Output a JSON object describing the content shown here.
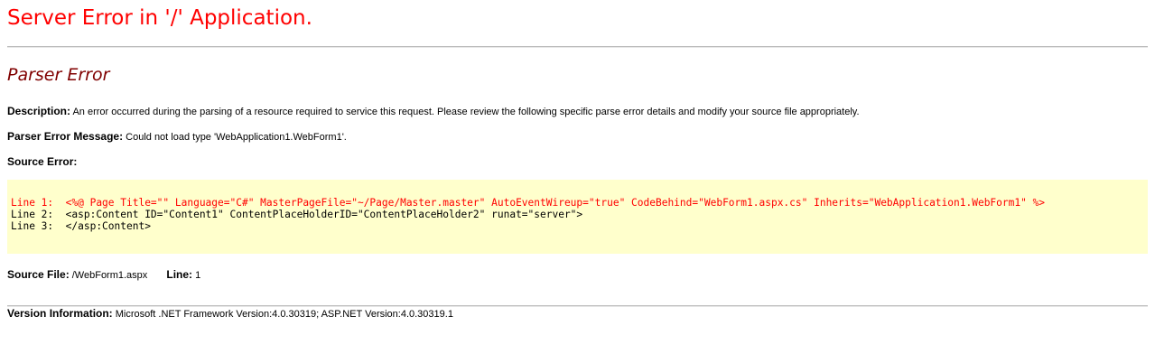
{
  "page_title": "Server Error in '/' Application.",
  "error_heading": "Parser Error",
  "description": {
    "label": "Description:",
    "text": "An error occurred during the parsing of a resource required to service this request. Please review the following specific parse error details and modify your source file appropriately."
  },
  "parser_error_message": {
    "label": "Parser Error Message:",
    "text": "Could not load type 'WebApplication1.WebForm1'."
  },
  "source_error": {
    "label": "Source Error:",
    "lines": [
      {
        "prefix": "Line 1:",
        "code": "<%@ Page Title=\"\" Language=\"C#\" MasterPageFile=\"~/Page/Master.master\" AutoEventWireup=\"true\" CodeBehind=\"WebForm1.aspx.cs\" Inherits=\"WebApplication1.WebForm1\" %>",
        "highlighted": true
      },
      {
        "prefix": "Line 2:",
        "code": "<asp:Content ID=\"Content1\" ContentPlaceHolderID=\"ContentPlaceHolder2\" runat=\"server\">",
        "highlighted": false
      },
      {
        "prefix": "Line 3:",
        "code": "</asp:Content>",
        "highlighted": false
      }
    ]
  },
  "source_file": {
    "label": "Source File:",
    "value": "/WebForm1.aspx",
    "line_label": "Line:",
    "line_value": "1"
  },
  "version_information": {
    "label": "Version Information:",
    "text": "Microsoft .NET Framework Version:4.0.30319; ASP.NET Version:4.0.30319.1"
  },
  "colors": {
    "title": "#ff0000",
    "heading": "#800000",
    "code_background": "#ffffcc",
    "error_line": "#ff0000"
  }
}
